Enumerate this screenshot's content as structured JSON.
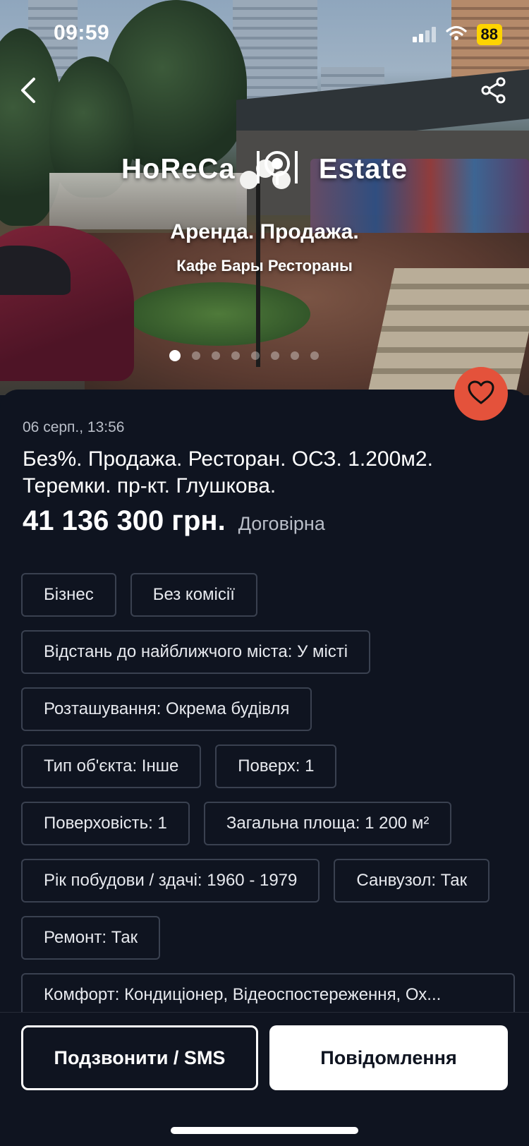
{
  "status_bar": {
    "time": "09:59",
    "battery": "88"
  },
  "hero": {
    "brand_left": "HoReCa",
    "brand_right": "Estate",
    "tagline": "Аренда. Продажа.",
    "subtagline": "Кафе Бары Рестораны",
    "slide_count": 8,
    "active_slide": 1
  },
  "listing": {
    "date": "06 серп., 13:56",
    "title": "Без%. Продажа. Ресторан. ОСЗ. 1.200м2. Теремки. пр-кт. Глушкова.",
    "price": "41 136 300 грн.",
    "price_note": "Договірна"
  },
  "tags": {
    "business": "Бізнес",
    "no_commission": "Без комісії",
    "distance": "Відстань до найближчого міста: У місті",
    "location": "Розташування: Окрема будівля",
    "object_type": "Тип об'єкта: Інше",
    "floor": "Поверх: 1",
    "floors_total": "Поверховість: 1",
    "total_area": "Загальна площа: 1 200 м²",
    "build_year": "Рік побудови / здачі: 1960 - 1979",
    "bathroom": "Санвузол: Так",
    "renovation": "Ремонт: Так",
    "comfort": "Комфорт: Кондиціонер, Відеоспостереження, Ох..."
  },
  "actions": {
    "call_label": "Подзвонити / SMS",
    "message_label": "Повідомлення"
  },
  "colors": {
    "background": "#0f1420",
    "favorite": "#e4523b",
    "battery": "#ffd400",
    "tag_border": "#3a4150"
  },
  "icons": [
    "back-chevron-icon",
    "share-icon",
    "heart-icon",
    "signal-icon",
    "wifi-icon",
    "cutlery-icon"
  ]
}
